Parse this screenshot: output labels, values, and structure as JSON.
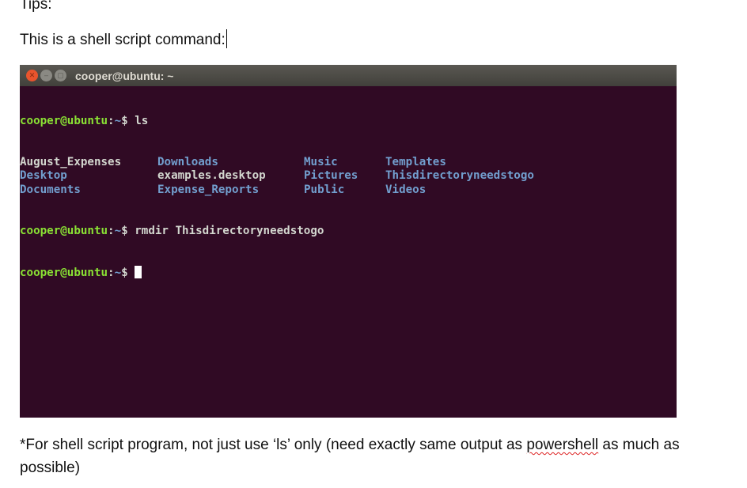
{
  "document": {
    "heading": "Tips:",
    "intro": "This is a shell script command:",
    "note_before": "*For shell script program, not just use ‘ls’ only (need exactly same output as ",
    "note_misspelled": "powershell",
    "note_after": " as much as possible)"
  },
  "terminal": {
    "title": "cooper@ubuntu: ~",
    "window_buttons": [
      "close",
      "minimize",
      "maximize"
    ],
    "prompt_user": "cooper@ubuntu",
    "prompt_sep": ":",
    "prompt_path": "~",
    "prompt_symbol": "$",
    "commands": [
      "ls",
      "rmdir Thisdirectoryneedstogo"
    ],
    "ls_output": [
      [
        {
          "name": "August_Expenses",
          "type": "file"
        },
        {
          "name": "Downloads",
          "type": "dir"
        },
        {
          "name": "Music",
          "type": "dir"
        },
        {
          "name": "Templates",
          "type": "dir"
        }
      ],
      [
        {
          "name": "Desktop",
          "type": "dir"
        },
        {
          "name": "examples.desktop",
          "type": "file"
        },
        {
          "name": "Pictures",
          "type": "dir"
        },
        {
          "name": "Thisdirectoryneedstogo",
          "type": "dir"
        }
      ],
      [
        {
          "name": "Documents",
          "type": "dir"
        },
        {
          "name": "Expense_Reports",
          "type": "dir"
        },
        {
          "name": "Public",
          "type": "dir"
        },
        {
          "name": "Videos",
          "type": "dir"
        }
      ]
    ],
    "colors": {
      "background": "#300a24",
      "prompt_user": "#8ae234",
      "directory": "#729fcf",
      "text": "#d3d7cf",
      "close_button": "#e9542d"
    }
  }
}
